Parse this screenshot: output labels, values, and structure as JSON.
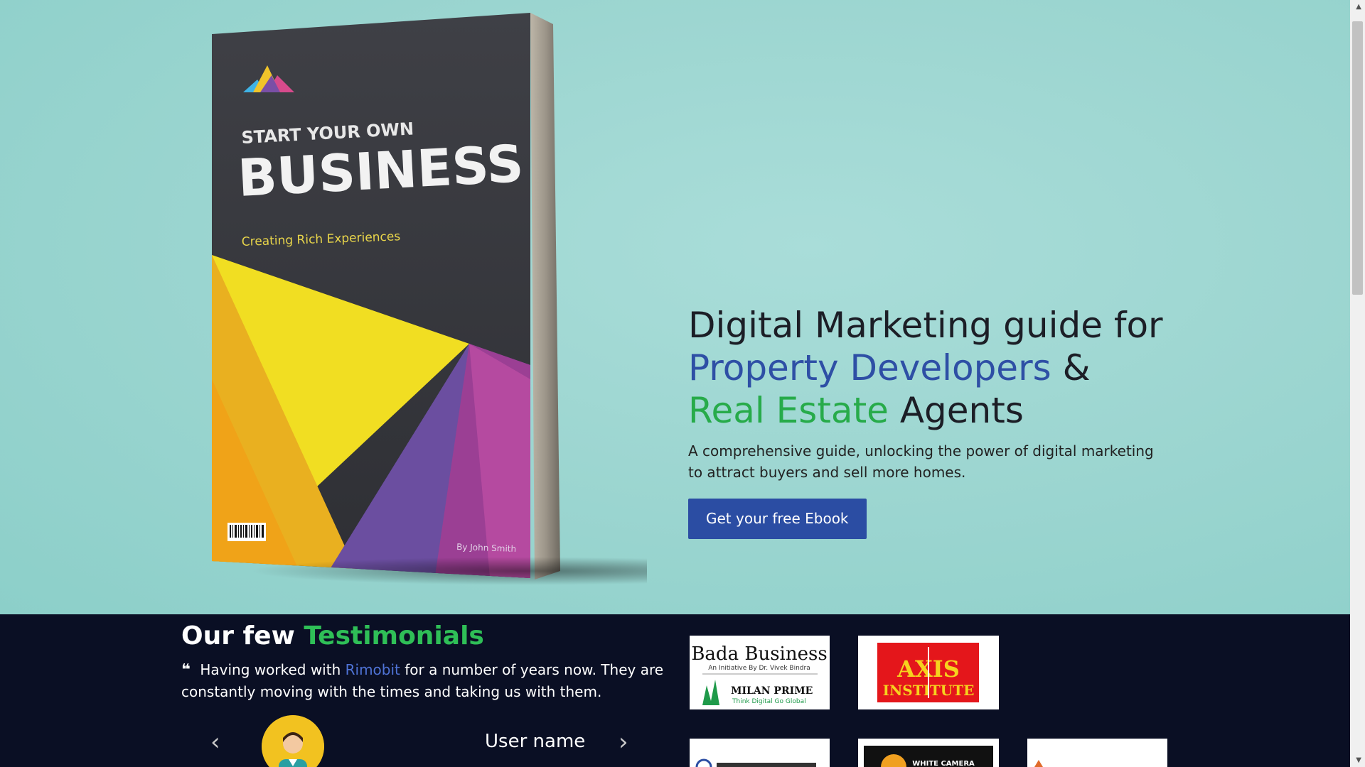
{
  "book": {
    "kicker": "START YOUR OWN",
    "title": "BUSINESS",
    "tagline": "Creating Rich Experiences",
    "author": "By John Smith"
  },
  "hero": {
    "line1": "Digital Marketing guide for",
    "line2_highlight": "Property Developers",
    "line2_rest": " &",
    "line3_highlight": "Real Estate",
    "line3_rest": " Agents",
    "subtitle": "A comprehensive guide, unlocking the power of digital marketing to attract buyers and sell more homes.",
    "cta_label": "Get your free Ebook"
  },
  "testimonials": {
    "title_prefix": "Our few ",
    "title_highlight": "Testimonials",
    "quote_before": "Having worked with ",
    "quote_link": "Rimobit",
    "quote_after": " for a number of years now. They are constantly moving with the times and taking us with them.",
    "user_name": "User name",
    "prev_icon": "‹",
    "next_icon": "›"
  },
  "logos": {
    "bada_title": "Bada Business",
    "bada_sub": "An Initiative By Dr. Vivek Bindra",
    "milan_title": "MILAN PRIME",
    "milan_sub": "Think Digital Go Global",
    "axis_line1": "AXIS",
    "axis_line2": "INSTITUTE",
    "whitecamera": "WHITE CAMERA"
  },
  "colors": {
    "accent_blue": "#2e4fa5",
    "accent_green": "#27ab4a",
    "dark_bg": "#0a0f24",
    "hero_bg": "#9dd6d1"
  }
}
